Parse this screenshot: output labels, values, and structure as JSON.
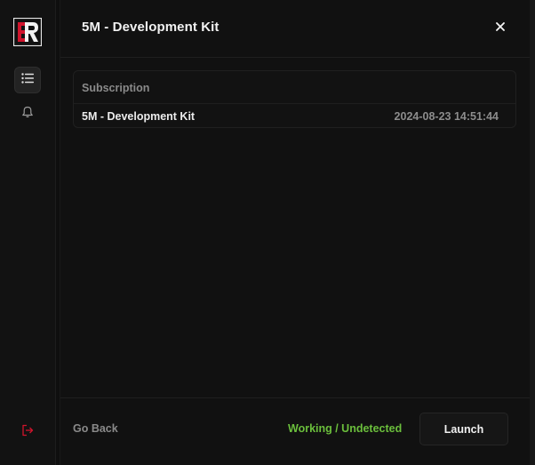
{
  "modal": {
    "title": "5M - Development Kit",
    "close_label": "×"
  },
  "subscription": {
    "header": "Subscription",
    "name": "5M - Development Kit",
    "date": "2024-08-23 14:51:44"
  },
  "footer": {
    "go_back": "Go Back",
    "status": "Working / Undetected",
    "launch": "Launch"
  },
  "colors": {
    "status_green": "#6bbf3c",
    "logo_red": "#d0142c",
    "logout_red": "#d0142c"
  },
  "icons": {
    "logo": "app-logo",
    "list": "list-icon",
    "bell": "bell-icon",
    "logout": "logout-icon",
    "close": "close-icon"
  }
}
